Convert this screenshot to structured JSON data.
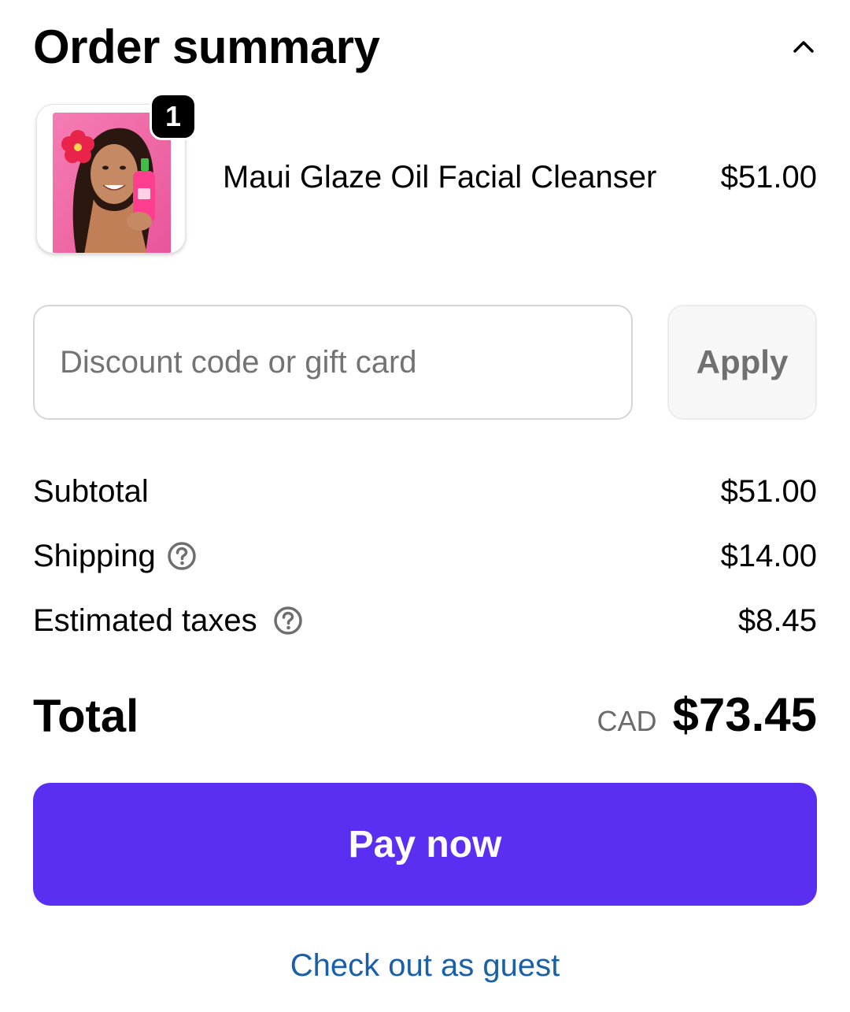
{
  "header": {
    "title": "Order summary",
    "toggle_icon": "chevron-up-icon"
  },
  "product": {
    "name": "Maui Glaze Oil Facial Cleanser",
    "price": "$51.00",
    "quantity": "1",
    "image_description": "product-photo"
  },
  "discount": {
    "placeholder": "Discount code or gift card",
    "value": "",
    "apply_label": "Apply"
  },
  "lines": {
    "subtotal": {
      "label": "Subtotal",
      "value": "$51.00"
    },
    "shipping": {
      "label": "Shipping",
      "value": "$14.00",
      "icon": "help-circle-icon"
    },
    "taxes": {
      "label": "Estimated taxes",
      "value": "$8.45",
      "icon": "help-circle-icon"
    }
  },
  "total": {
    "label": "Total",
    "currency": "CAD",
    "value": "$73.45"
  },
  "actions": {
    "pay_label": "Pay now",
    "guest_label": "Check out as guest"
  },
  "colors": {
    "primary": "#5b2ff2",
    "link": "#1a5fa8",
    "muted": "#6b6b6b"
  }
}
